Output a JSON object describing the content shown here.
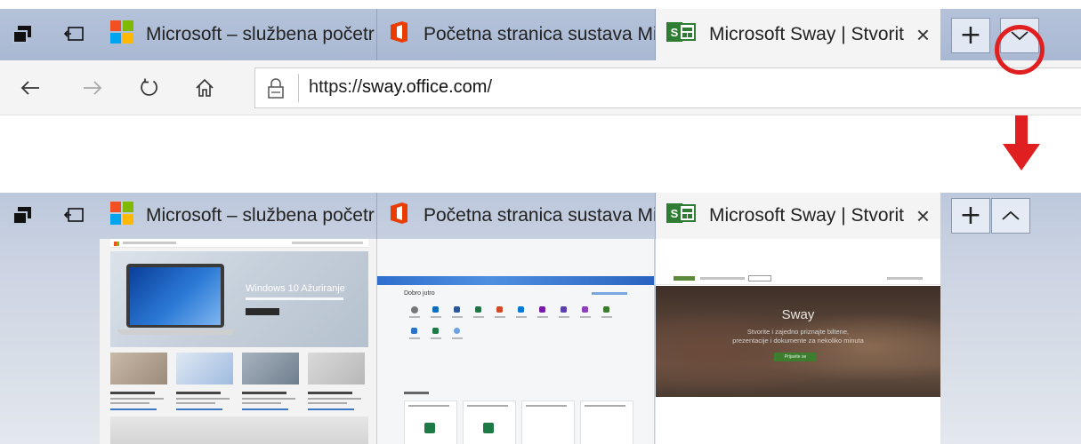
{
  "colors": {
    "tabbar_bg": "#aab9d3",
    "active_tab_bg": "#f4f4f4",
    "highlight_red": "#e02020",
    "ms_red": "#f25022",
    "ms_green": "#7fba00",
    "ms_blue": "#00a4ef",
    "ms_yellow": "#ffb900",
    "office_orange": "#eb3c00",
    "sway_green": "#2e7d32"
  },
  "top_browser": {
    "tab_icons": [
      "tab-set-aside-icon",
      "show-tabs-aside-icon"
    ],
    "tabs": [
      {
        "label": "Microsoft – službena početr",
        "favicon": "microsoft-logo-icon",
        "active": false
      },
      {
        "label": "Početna stranica sustava Mi",
        "favicon": "office-logo-icon",
        "active": false
      },
      {
        "label": "Microsoft Sway | Stvorit",
        "favicon": "sway-logo-icon",
        "active": true,
        "close": "×"
      }
    ],
    "new_tab_symbol": "+",
    "tab_preview_toggle": "chevron-down-icon",
    "nav": [
      "back-arrow-icon",
      "forward-arrow-icon",
      "refresh-icon",
      "home-icon"
    ],
    "url_prefix": "https://",
    "url_domain": "sway.office.com",
    "url_suffix": "/"
  },
  "bottom_browser": {
    "tabs": [
      {
        "label": "Microsoft – službena početr",
        "favicon": "microsoft-logo-icon",
        "active": false
      },
      {
        "label": "Početna stranica sustava Mi",
        "favicon": "office-logo-icon",
        "active": false
      },
      {
        "label": "Microsoft Sway | Stvorit",
        "favicon": "sway-logo-icon",
        "active": true,
        "close": "×"
      }
    ],
    "new_tab_symbol": "+",
    "tab_preview_toggle": "chevron-up-icon",
    "previews": {
      "microsoft": {
        "hero_title": "Windows 10 Ažuriranje"
      },
      "office": {
        "greeting": "Dobro jutro"
      },
      "sway": {
        "title": "Sway",
        "subtitle_line1": "Stvorite i zajedno priznajte biltene,",
        "subtitle_line2": "prezentacije i dokumente za nekoliko minuta",
        "cta": "Prijavite se"
      }
    }
  }
}
